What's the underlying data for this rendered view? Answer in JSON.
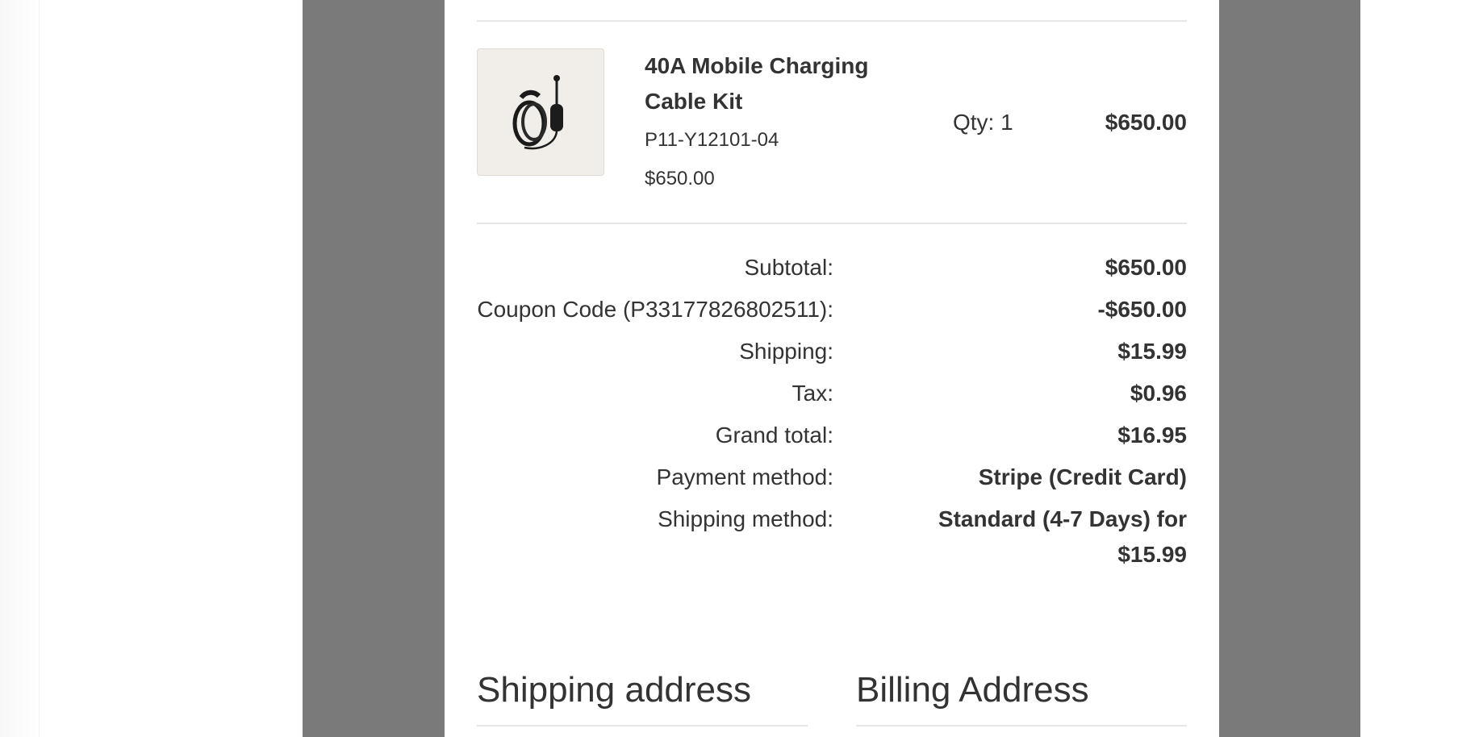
{
  "order_item": {
    "name": "40A Mobile Charging Cable Kit",
    "sku": "P11-Y12101-04",
    "unit_price": "$650.00",
    "quantity": "Qty: 1",
    "line_total": "$650.00",
    "image_icon": "charging-cable-icon"
  },
  "totals": {
    "subtotal_label": "Subtotal:",
    "subtotal_value": "$650.00",
    "coupon_label": "Coupon Code (P33177826802511):",
    "coupon_value": "-$650.00",
    "shipping_label": "Shipping:",
    "shipping_value": "$15.99",
    "tax_label": "Tax:",
    "tax_value": "$0.96",
    "grand_total_label": "Grand total:",
    "grand_total_value": "$16.95",
    "payment_method_label": "Payment method:",
    "payment_method_value": "Stripe (Credit Card)",
    "shipping_method_label": "Shipping method:",
    "shipping_method_value": "Standard (4-7 Days) for $15.99"
  },
  "addresses": {
    "shipping_title": "Shipping address",
    "billing_title": "Billing Address"
  },
  "colors": {
    "overlay": "#7a7a7a",
    "text": "#333333",
    "divider": "#e6e6e6",
    "thumb_bg": "#f1ede9"
  }
}
